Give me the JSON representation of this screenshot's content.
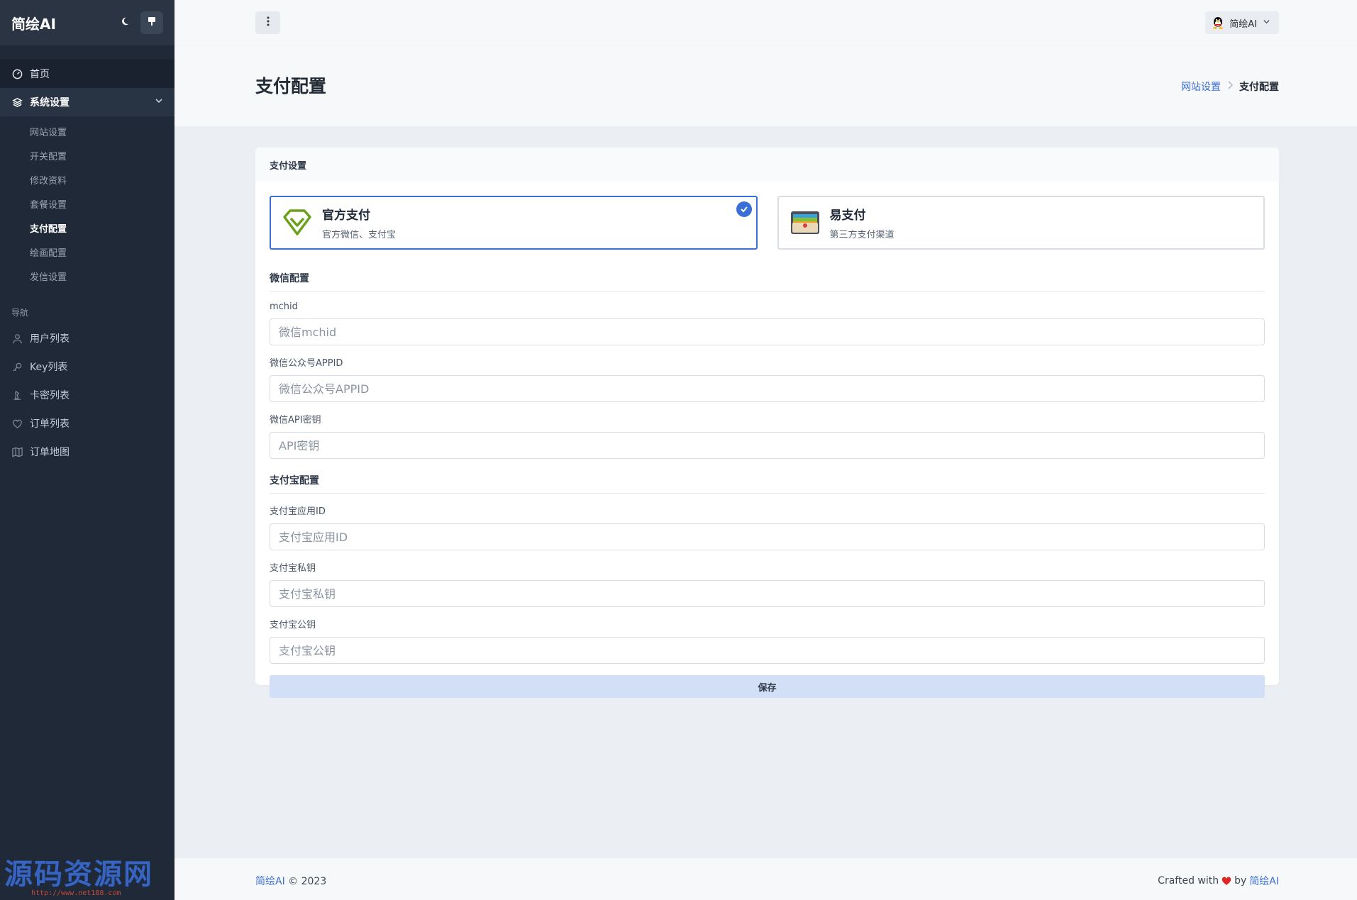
{
  "sidebar": {
    "brand": "简绘AI",
    "home": "首页",
    "group_label": "系统设置",
    "sub_items": [
      "网站设置",
      "开关配置",
      "修改资料",
      "套餐设置",
      "支付配置",
      "绘画配置",
      "发信设置"
    ],
    "nav_heading": "导航",
    "nav_items": [
      "用户列表",
      "Key列表",
      "卡密列表",
      "订单列表",
      "订单地图"
    ]
  },
  "watermark": {
    "big": "源码资源网",
    "small": "http://www.net188.com"
  },
  "topbar": {
    "user_name": "简绘AI"
  },
  "page": {
    "title": "支付配置",
    "breadcrumb_parent": "网站设置",
    "breadcrumb_current": "支付配置"
  },
  "card": {
    "header": "支付设置",
    "options": [
      {
        "title": "官方支付",
        "desc": "官方微信、支付宝",
        "selected": true
      },
      {
        "title": "易支付",
        "desc": "第三方支付渠道",
        "selected": false
      }
    ],
    "wechat_section": "微信配置",
    "alipay_section": "支付宝配置",
    "fields": {
      "mchid": {
        "label": "mchid",
        "placeholder": "微信mchid"
      },
      "appid": {
        "label": "微信公众号APPID",
        "placeholder": "微信公众号APPID"
      },
      "apikey": {
        "label": "微信API密钥",
        "placeholder": "API密钥"
      },
      "ali_appid": {
        "label": "支付宝应用ID",
        "placeholder": "支付宝应用ID"
      },
      "ali_private": {
        "label": "支付宝私钥",
        "placeholder": "支付宝私钥"
      },
      "ali_public": {
        "label": "支付宝公钥",
        "placeholder": "支付宝公钥"
      }
    },
    "save_label": "保存"
  },
  "footer": {
    "brand": "简绘AI",
    "copyright": "© 2023",
    "crafted": "Crafted with",
    "by": "by",
    "brand2": "简绘AI"
  },
  "colors": {
    "accent": "#3c6fd6",
    "sidebar": "#1f2937",
    "heart": "#e02424"
  }
}
